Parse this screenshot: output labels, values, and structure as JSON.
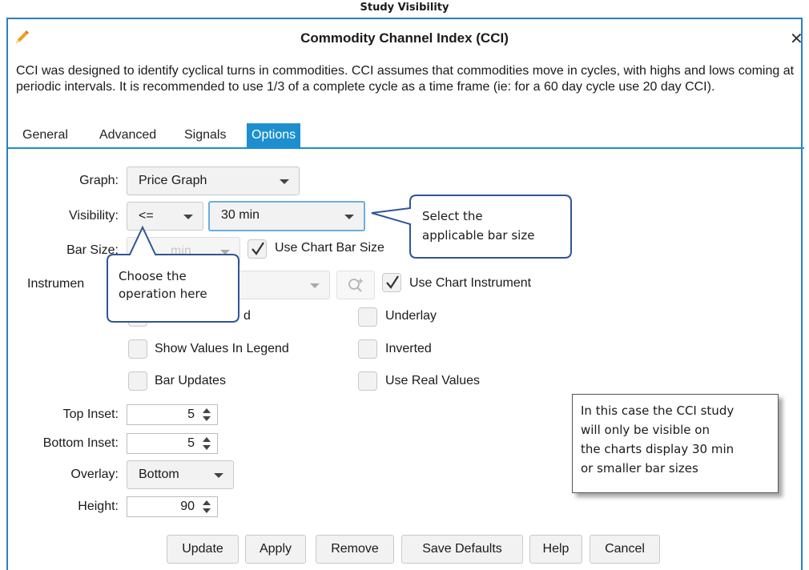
{
  "caption": "Study Visibility",
  "dialog": {
    "title": "Commodity Channel Index (CCI)",
    "close_symbol": "✕",
    "description": "CCI was designed to identify cyclical turns in commodities.  CCI assumes that commodities move in cycles, with highs and lows coming at periodic intervals.  It is recommended to use 1/3 of a complete cycle as a time frame (ie: for a 60 day cycle use 20 day CCI)."
  },
  "tabs": [
    {
      "label": "General",
      "active": false
    },
    {
      "label": "Advanced",
      "active": false
    },
    {
      "label": "Signals",
      "active": false
    },
    {
      "label": "Options",
      "active": true
    }
  ],
  "form": {
    "graph_label": "Graph:",
    "graph_value": "Price Graph",
    "visibility_label": "Visibility:",
    "visibility_operator": "<=",
    "visibility_value": "30 min",
    "bar_size_label": "Bar Size:",
    "bar_size_value": "min",
    "use_chart_bar_size_label": "Use Chart Bar Size",
    "use_chart_bar_size_checked": true,
    "instrument_label": "Instrumen",
    "use_chart_instrument_label": "Use Chart Instrument",
    "use_chart_instrument_checked": true,
    "show_in_legend_partial": "d",
    "underlay_label": "Underlay",
    "show_values_in_legend_label": "Show Values In Legend",
    "inverted_label": "Inverted",
    "bar_updates_label": "Bar Updates",
    "use_real_values_label": "Use Real Values",
    "top_inset_label": "Top Inset:",
    "top_inset_value": "5",
    "bottom_inset_label": "Bottom Inset:",
    "bottom_inset_value": "5",
    "overlay_label": "Overlay:",
    "overlay_value": "Bottom",
    "height_label": "Height:",
    "height_value": "90"
  },
  "buttons": {
    "update": "Update",
    "apply": "Apply",
    "remove": "Remove",
    "save_defaults": "Save Defaults",
    "help": "Help",
    "cancel": "Cancel"
  },
  "callouts": {
    "bar_size_line1": "Select the",
    "bar_size_line2": "applicable bar size",
    "operation_line1": "Choose the",
    "operation_line2": "operation here",
    "note_line1": "In this case the CCI study",
    "note_line2": "will only be visible on",
    "note_line3": "the charts display 30 min",
    "note_line4": "or smaller bar sizes"
  },
  "colors": {
    "accent": "#1d8fcf",
    "callout_border": "#2f5597",
    "pencil": "#f0a020"
  }
}
